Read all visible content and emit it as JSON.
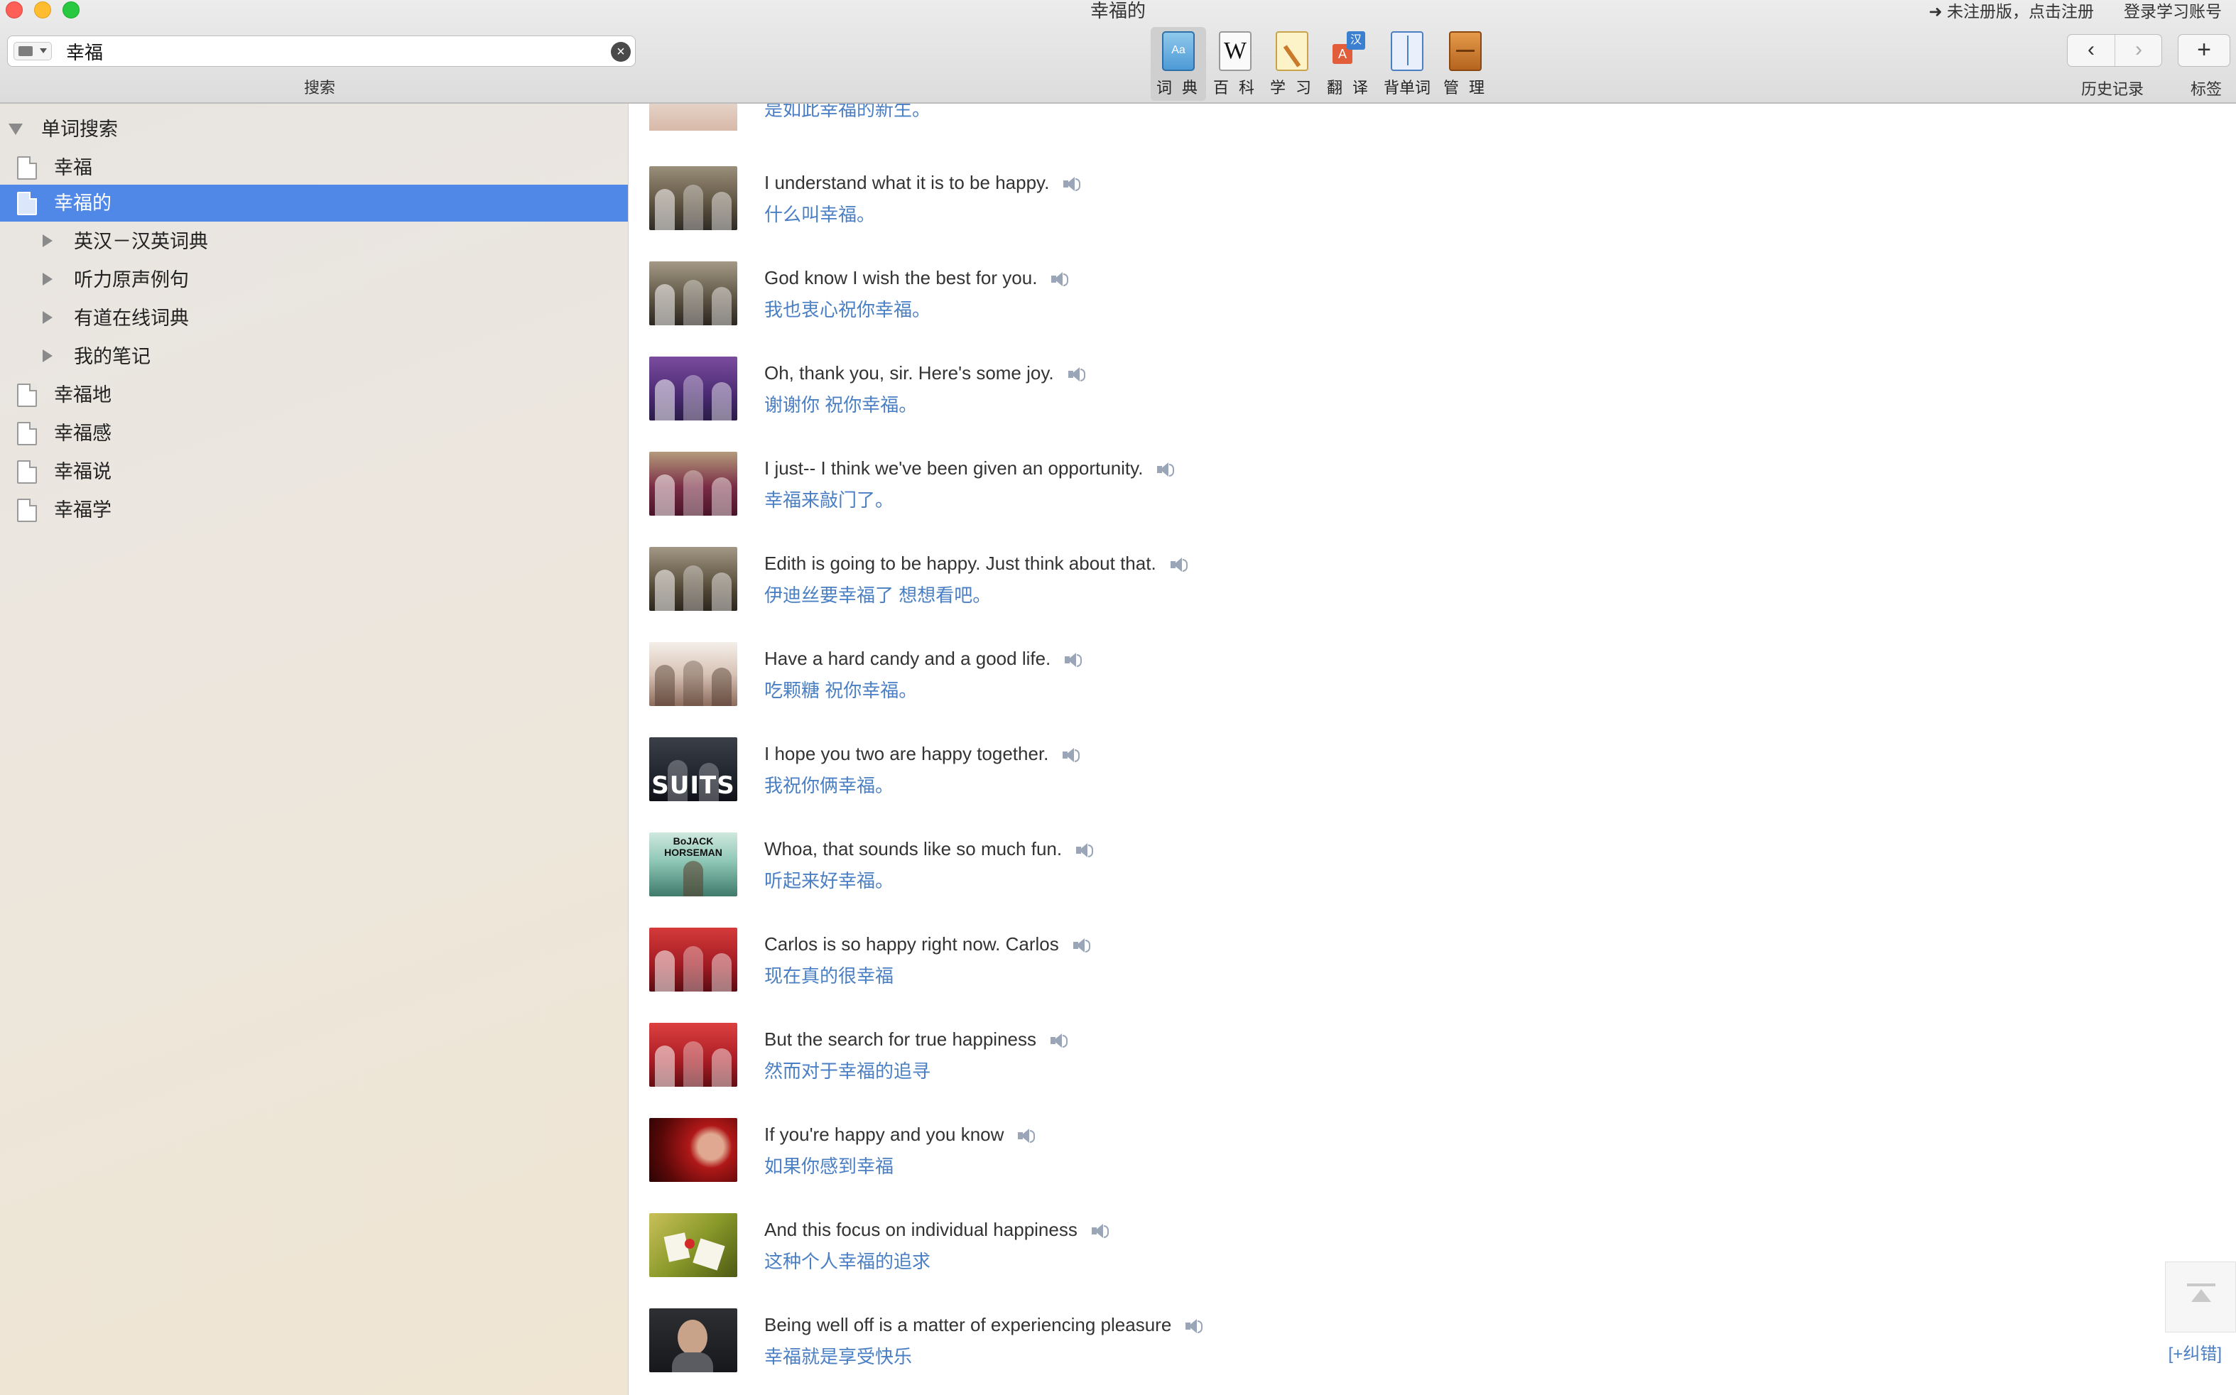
{
  "window": {
    "title": "幸福的",
    "register_link": "➜ 未注册版，点击注册",
    "login_link": "登录学习账号"
  },
  "search": {
    "value": "幸福",
    "caption": "搜索",
    "clear_glyph": "×"
  },
  "toolbar": {
    "tools": [
      {
        "label": "词 典",
        "icon": "dictionary-icon",
        "active": true
      },
      {
        "label": "百 科",
        "icon": "wikipedia-icon"
      },
      {
        "label": "学 习",
        "icon": "study-icon"
      },
      {
        "label": "翻 译",
        "icon": "translate-icon"
      },
      {
        "label": "背单词",
        "icon": "wordbook-icon"
      },
      {
        "label": "管 理",
        "icon": "manage-icon"
      }
    ],
    "dict_icon_text": "Aa",
    "wiki_icon_text": "W",
    "trans_icon_a": "A",
    "trans_icon_z": "汉",
    "back_glyph": "‹",
    "forward_glyph": "›",
    "add_glyph": "+",
    "history_label": "历史记录",
    "bookmark_label": "标签"
  },
  "sidebar": {
    "root_label": "单词搜索",
    "items": [
      {
        "label": "幸福"
      },
      {
        "label": "幸福的",
        "selected": true
      },
      {
        "label": "英汉－汉英词典",
        "child": true
      },
      {
        "label": "听力原声例句",
        "child": true
      },
      {
        "label": "有道在线词典",
        "child": true
      },
      {
        "label": "我的笔记",
        "child": true
      },
      {
        "label": "幸福地"
      },
      {
        "label": "幸福感"
      },
      {
        "label": "幸福说"
      },
      {
        "label": "幸福学"
      }
    ]
  },
  "content": {
    "partial_top_zh": "是如此幸福的新生。",
    "examples": [
      {
        "en": "I understand what it is to be happy.",
        "zh": "什么叫幸福。"
      },
      {
        "en": "God know I wish the best for you.",
        "zh": "我也衷心祝你幸福。"
      },
      {
        "en": "Oh, thank you, sir. Here's some joy.",
        "zh": "谢谢你 祝你幸福。"
      },
      {
        "en": "I just-- I think we've been given an opportunity.",
        "zh": "幸福来敲门了。"
      },
      {
        "en": "Edith is going to be happy. Just think about that.",
        "zh": "伊迪丝要幸福了 想想看吧。"
      },
      {
        "en": "Have a hard candy and a good life.",
        "zh": "吃颗糖 祝你幸福。"
      },
      {
        "en": "I hope you two are happy together.",
        "zh": "我祝你俩幸福。"
      },
      {
        "en": "Whoa, that sounds like so much fun.",
        "zh": "听起来好幸福。"
      },
      {
        "en": "Carlos is so happy right now. Carlos",
        "zh": "现在真的很幸福"
      },
      {
        "en": "But the search for true happiness",
        "zh": "然而对于幸福的追寻"
      },
      {
        "en": "If you're happy and you know",
        "zh": "如果你感到幸福"
      },
      {
        "en": "And this focus on individual happiness",
        "zh": "这种个人幸福的追求"
      },
      {
        "en": "Being well off is a matter of experiencing pleasure",
        "zh": "幸福就是享受快乐"
      }
    ],
    "thumb_captions": {
      "suits": "SUITS",
      "bojack": "BoJACK HORSEMAN"
    },
    "correct_link": "[+纠错]"
  }
}
